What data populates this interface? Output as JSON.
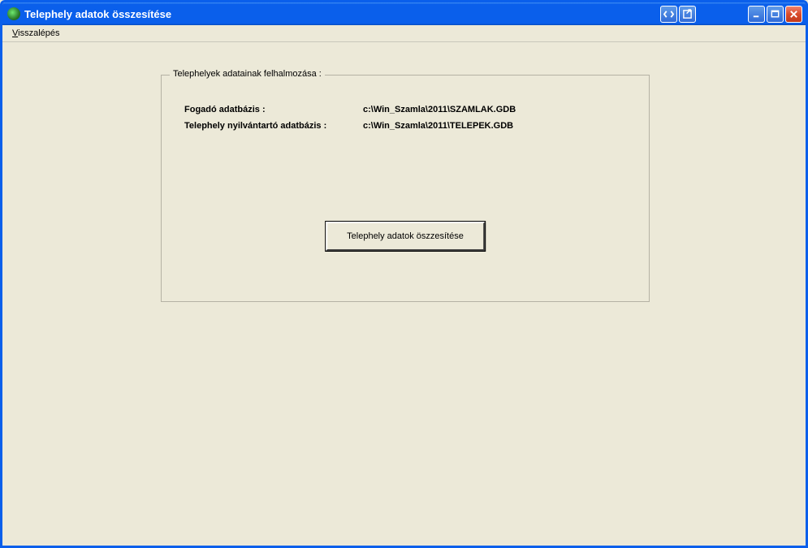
{
  "window": {
    "title": "Telephely adatok összesítése"
  },
  "menu": {
    "item1_pre": "V",
    "item1_rest": "isszalépés"
  },
  "group": {
    "legend": "Telephelyek adatainak felhalmozása :",
    "field1_label": "Fogadó adatbázis :",
    "field1_value": "c:\\Win_Szamla\\2011\\SZAMLAK.GDB",
    "field2_label": "Telephely nyilvántartó adatbázis :",
    "field2_value": "c:\\Win_Szamla\\2011\\TELEPEK.GDB"
  },
  "actions": {
    "summarize": "Telephely adatok öszzesítése"
  }
}
